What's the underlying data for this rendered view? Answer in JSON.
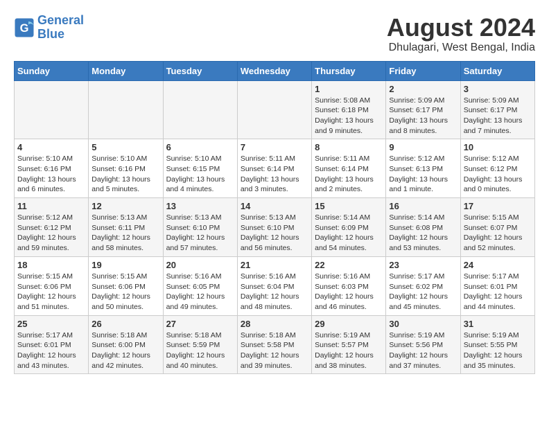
{
  "header": {
    "logo_line1": "General",
    "logo_line2": "Blue",
    "title": "August 2024",
    "subtitle": "Dhulagari, West Bengal, India"
  },
  "calendar": {
    "days_of_week": [
      "Sunday",
      "Monday",
      "Tuesday",
      "Wednesday",
      "Thursday",
      "Friday",
      "Saturday"
    ],
    "weeks": [
      [
        {
          "day": "",
          "content": ""
        },
        {
          "day": "",
          "content": ""
        },
        {
          "day": "",
          "content": ""
        },
        {
          "day": "",
          "content": ""
        },
        {
          "day": "1",
          "content": "Sunrise: 5:08 AM\nSunset: 6:18 PM\nDaylight: 13 hours\nand 9 minutes."
        },
        {
          "day": "2",
          "content": "Sunrise: 5:09 AM\nSunset: 6:17 PM\nDaylight: 13 hours\nand 8 minutes."
        },
        {
          "day": "3",
          "content": "Sunrise: 5:09 AM\nSunset: 6:17 PM\nDaylight: 13 hours\nand 7 minutes."
        }
      ],
      [
        {
          "day": "4",
          "content": "Sunrise: 5:10 AM\nSunset: 6:16 PM\nDaylight: 13 hours\nand 6 minutes."
        },
        {
          "day": "5",
          "content": "Sunrise: 5:10 AM\nSunset: 6:16 PM\nDaylight: 13 hours\nand 5 minutes."
        },
        {
          "day": "6",
          "content": "Sunrise: 5:10 AM\nSunset: 6:15 PM\nDaylight: 13 hours\nand 4 minutes."
        },
        {
          "day": "7",
          "content": "Sunrise: 5:11 AM\nSunset: 6:14 PM\nDaylight: 13 hours\nand 3 minutes."
        },
        {
          "day": "8",
          "content": "Sunrise: 5:11 AM\nSunset: 6:14 PM\nDaylight: 13 hours\nand 2 minutes."
        },
        {
          "day": "9",
          "content": "Sunrise: 5:12 AM\nSunset: 6:13 PM\nDaylight: 13 hours\nand 1 minute."
        },
        {
          "day": "10",
          "content": "Sunrise: 5:12 AM\nSunset: 6:12 PM\nDaylight: 13 hours\nand 0 minutes."
        }
      ],
      [
        {
          "day": "11",
          "content": "Sunrise: 5:12 AM\nSunset: 6:12 PM\nDaylight: 12 hours\nand 59 minutes."
        },
        {
          "day": "12",
          "content": "Sunrise: 5:13 AM\nSunset: 6:11 PM\nDaylight: 12 hours\nand 58 minutes."
        },
        {
          "day": "13",
          "content": "Sunrise: 5:13 AM\nSunset: 6:10 PM\nDaylight: 12 hours\nand 57 minutes."
        },
        {
          "day": "14",
          "content": "Sunrise: 5:13 AM\nSunset: 6:10 PM\nDaylight: 12 hours\nand 56 minutes."
        },
        {
          "day": "15",
          "content": "Sunrise: 5:14 AM\nSunset: 6:09 PM\nDaylight: 12 hours\nand 54 minutes."
        },
        {
          "day": "16",
          "content": "Sunrise: 5:14 AM\nSunset: 6:08 PM\nDaylight: 12 hours\nand 53 minutes."
        },
        {
          "day": "17",
          "content": "Sunrise: 5:15 AM\nSunset: 6:07 PM\nDaylight: 12 hours\nand 52 minutes."
        }
      ],
      [
        {
          "day": "18",
          "content": "Sunrise: 5:15 AM\nSunset: 6:06 PM\nDaylight: 12 hours\nand 51 minutes."
        },
        {
          "day": "19",
          "content": "Sunrise: 5:15 AM\nSunset: 6:06 PM\nDaylight: 12 hours\nand 50 minutes."
        },
        {
          "day": "20",
          "content": "Sunrise: 5:16 AM\nSunset: 6:05 PM\nDaylight: 12 hours\nand 49 minutes."
        },
        {
          "day": "21",
          "content": "Sunrise: 5:16 AM\nSunset: 6:04 PM\nDaylight: 12 hours\nand 48 minutes."
        },
        {
          "day": "22",
          "content": "Sunrise: 5:16 AM\nSunset: 6:03 PM\nDaylight: 12 hours\nand 46 minutes."
        },
        {
          "day": "23",
          "content": "Sunrise: 5:17 AM\nSunset: 6:02 PM\nDaylight: 12 hours\nand 45 minutes."
        },
        {
          "day": "24",
          "content": "Sunrise: 5:17 AM\nSunset: 6:01 PM\nDaylight: 12 hours\nand 44 minutes."
        }
      ],
      [
        {
          "day": "25",
          "content": "Sunrise: 5:17 AM\nSunset: 6:01 PM\nDaylight: 12 hours\nand 43 minutes."
        },
        {
          "day": "26",
          "content": "Sunrise: 5:18 AM\nSunset: 6:00 PM\nDaylight: 12 hours\nand 42 minutes."
        },
        {
          "day": "27",
          "content": "Sunrise: 5:18 AM\nSunset: 5:59 PM\nDaylight: 12 hours\nand 40 minutes."
        },
        {
          "day": "28",
          "content": "Sunrise: 5:18 AM\nSunset: 5:58 PM\nDaylight: 12 hours\nand 39 minutes."
        },
        {
          "day": "29",
          "content": "Sunrise: 5:19 AM\nSunset: 5:57 PM\nDaylight: 12 hours\nand 38 minutes."
        },
        {
          "day": "30",
          "content": "Sunrise: 5:19 AM\nSunset: 5:56 PM\nDaylight: 12 hours\nand 37 minutes."
        },
        {
          "day": "31",
          "content": "Sunrise: 5:19 AM\nSunset: 5:55 PM\nDaylight: 12 hours\nand 35 minutes."
        }
      ]
    ]
  }
}
